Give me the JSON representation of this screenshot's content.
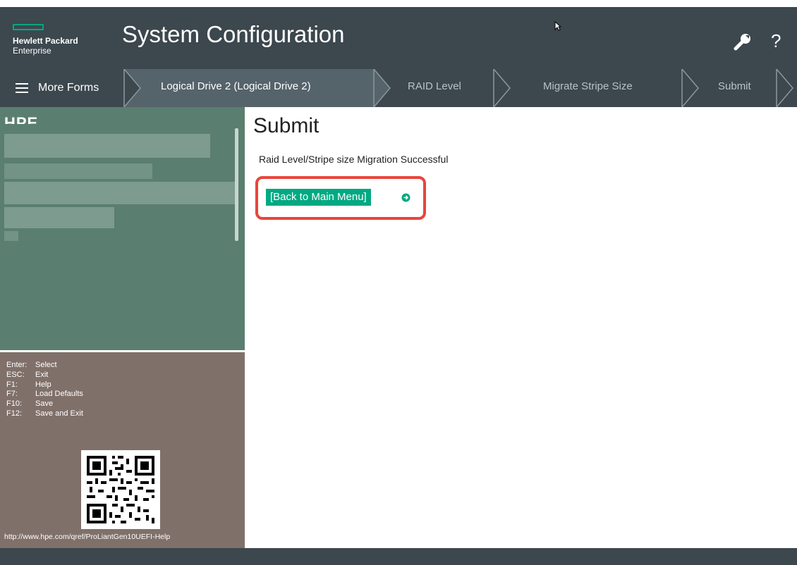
{
  "header": {
    "brand_line1": "Hewlett Packard",
    "brand_line2": "Enterprise",
    "title": "System Configuration",
    "wrench_icon": "wrench-icon",
    "help_label": "?"
  },
  "breadcrumb": {
    "menu_label": "More Forms",
    "items": [
      "Logical Drive 2 (Logical Drive 2)",
      "RAID Level",
      "Migrate Stripe Size",
      "Submit"
    ]
  },
  "info_panel": {
    "title": "HPE"
  },
  "keys_panel": {
    "keys": [
      {
        "key": "Enter:",
        "action": "Select"
      },
      {
        "key": "ESC:",
        "action": "Exit"
      },
      {
        "key": "F1:",
        "action": "Help"
      },
      {
        "key": "F7:",
        "action": "Load Defaults"
      },
      {
        "key": "F10:",
        "action": "Save"
      },
      {
        "key": "F12:",
        "action": "Save and Exit"
      }
    ],
    "help_url": "http://www.hpe.com/qref/ProLiantGen10UEFI-Help"
  },
  "main": {
    "title": "Submit",
    "message": "Raid Level/Stripe size Migration Successful",
    "back_button": "[Back to Main Menu]"
  },
  "colors": {
    "header_bg": "#3c474e",
    "accent": "#01a982",
    "info_bg": "#5a7e6f",
    "keys_bg": "#80706a",
    "highlight": "#e8453c"
  }
}
